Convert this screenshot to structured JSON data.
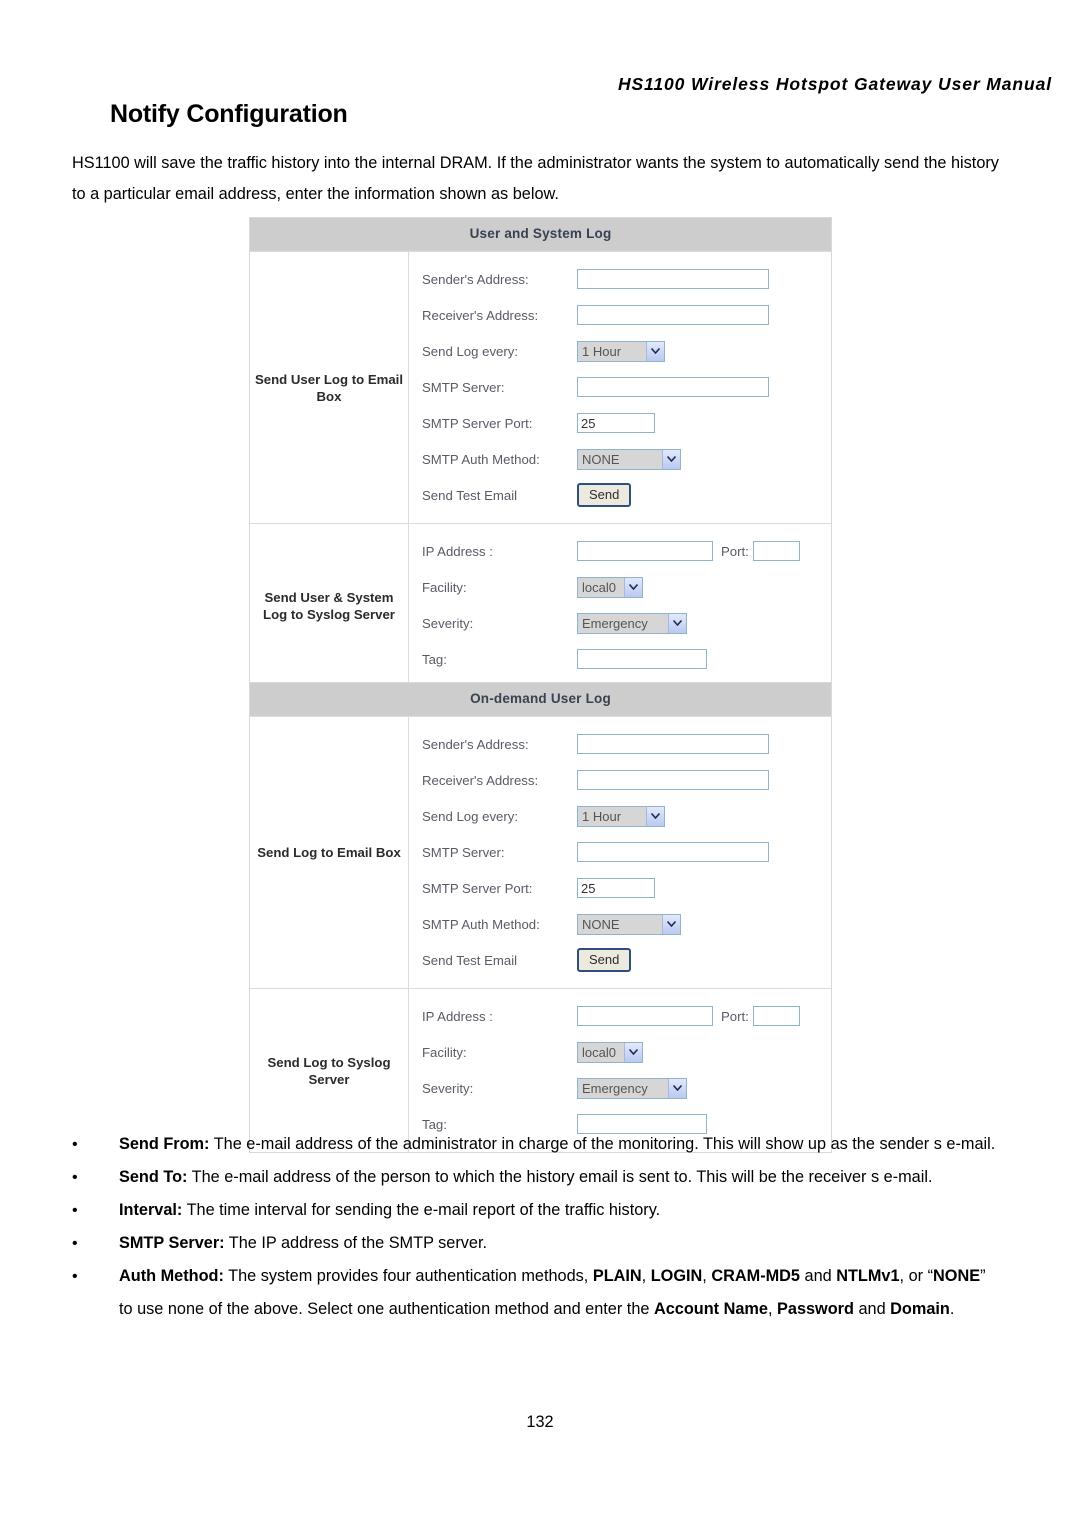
{
  "document": {
    "running_header": "HS1100 Wireless Hotspot Gateway User Manual",
    "title": "Notify Configuration",
    "intro": "HS1100 will save the traffic history into the internal DRAM. If the administrator wants the system to automatically send the history to a particular email address, enter the information shown as below.",
    "page_number": "132"
  },
  "colors": {
    "caption_bg": "#cdcdcd",
    "caption_text": "#384250",
    "field_border": "#8fb4cb",
    "select_bg": "#d6d6d6",
    "select_arrow": "#b9c9f2",
    "button_border": "#2e4f7a",
    "button_bg": "#eceade",
    "table_border": "#d9d9d9"
  },
  "tables": [
    {
      "caption": "User and System Log",
      "sections": [
        {
          "label": "Send User Log to Email Box",
          "rows": [
            {
              "label": "Sender's Address:",
              "control": "text",
              "value": "",
              "width": "wide"
            },
            {
              "label": "Receiver's Address:",
              "control": "text",
              "value": "",
              "width": "wide"
            },
            {
              "label": "Send Log every:",
              "control": "select",
              "value": "1 Hour",
              "width": "hour"
            },
            {
              "label": "SMTP Server:",
              "control": "text",
              "value": "",
              "width": "wide"
            },
            {
              "label": "SMTP Server Port:",
              "control": "text",
              "value": "25",
              "width": "port"
            },
            {
              "label": "SMTP Auth Method:",
              "control": "select",
              "value": "NONE",
              "width": "auth"
            },
            {
              "label": "Send Test Email",
              "control": "button",
              "value": "Send"
            }
          ]
        },
        {
          "label": "Send User & System Log to Syslog Server",
          "rows": [
            {
              "label": "IP Address :",
              "control": "ipport",
              "value": "",
              "inline_label": "Port:",
              "inline_value": ""
            },
            {
              "label": "Facility:",
              "control": "select",
              "value": "local0",
              "width": "fac"
            },
            {
              "label": "Severity:",
              "control": "select",
              "value": "Emergency",
              "width": "sev"
            },
            {
              "label": "Tag:",
              "control": "text",
              "value": "",
              "width": "tag"
            }
          ]
        }
      ]
    },
    {
      "caption": "On-demand User Log",
      "sections": [
        {
          "label": "Send Log to Email Box",
          "rows": [
            {
              "label": "Sender's Address:",
              "control": "text",
              "value": "",
              "width": "wide"
            },
            {
              "label": "Receiver's Address:",
              "control": "text",
              "value": "",
              "width": "wide"
            },
            {
              "label": "Send Log every:",
              "control": "select",
              "value": "1 Hour",
              "width": "hour"
            },
            {
              "label": "SMTP Server:",
              "control": "text",
              "value": "",
              "width": "wide"
            },
            {
              "label": "SMTP Server Port:",
              "control": "text",
              "value": "25",
              "width": "port"
            },
            {
              "label": "SMTP Auth Method:",
              "control": "select",
              "value": "NONE",
              "width": "auth"
            },
            {
              "label": "Send Test Email",
              "control": "button",
              "value": "Send"
            }
          ]
        },
        {
          "label": "Send Log to Syslog Server",
          "rows": [
            {
              "label": "IP Address :",
              "control": "ipport",
              "value": "",
              "inline_label": "Port:",
              "inline_value": ""
            },
            {
              "label": "Facility:",
              "control": "select",
              "value": "local0",
              "width": "fac"
            },
            {
              "label": "Severity:",
              "control": "select",
              "value": "Emergency",
              "width": "sev"
            },
            {
              "label": "Tag:",
              "control": "text",
              "value": "",
              "width": "tag"
            }
          ]
        }
      ]
    }
  ],
  "bullets": [
    {
      "term": "Send From:",
      "text": " The e-mail address of the administrator in charge of the monitoring. This will show up as the sender s e-mail."
    },
    {
      "term": "Send To:",
      "text": " The e-mail address of the person to which the history email is sent to. This will be the receiver s e-mail."
    },
    {
      "term": "Interval:",
      "text": " The time interval for sending the e-mail report of the traffic history."
    },
    {
      "term": "SMTP Server:",
      "text": " The IP address of the SMTP server."
    },
    {
      "term": "Auth Method:",
      "text": " The system provides four authentication methods, PLAIN, LOGIN, CRAM-MD5 and NTLMv1, or “NONE” to use none of the above. Select one authentication method and enter the Account Name, Password and Domain.",
      "bold_runs": [
        "PLAIN",
        "LOGIN",
        "CRAM-MD5",
        "NTLMv1",
        "NONE",
        "Account Name",
        "Password",
        "Domain"
      ]
    }
  ],
  "bullet_marker": "•"
}
